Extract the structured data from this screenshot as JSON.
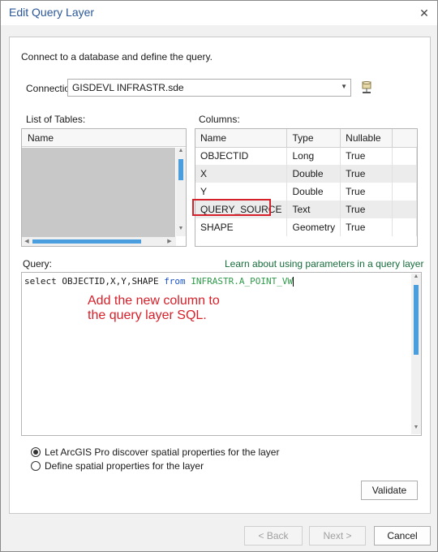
{
  "window": {
    "title": "Edit Query Layer"
  },
  "intro": "Connect to a database and define the query.",
  "connection": {
    "label": "Connection:",
    "value": "GISDEVL INFRASTR.sde"
  },
  "tables": {
    "label": "List of Tables:",
    "header": "Name"
  },
  "columns": {
    "label": "Columns:",
    "headers": [
      "Name",
      "Type",
      "Nullable"
    ],
    "rows": [
      [
        "OBJECTID",
        "Long",
        "True"
      ],
      [
        "X",
        "Double",
        "True"
      ],
      [
        "Y",
        "Double",
        "True"
      ],
      [
        "QUERY_SOURCE",
        "Text",
        "True"
      ],
      [
        "SHAPE",
        "Geometry",
        "True"
      ]
    ]
  },
  "query": {
    "label": "Query:",
    "learn_link": "Learn about using parameters in a query layer",
    "sql_prefix": "select OBJECTID,X,Y,SHAPE ",
    "sql_keyword": "from",
    "sql_table": "INFRASTR.A_POINT_VW",
    "annotation": "Add the new column to\nthe query layer SQL."
  },
  "options": {
    "discover": "Let ArcGIS Pro discover spatial properties for the layer",
    "define": "Define spatial properties for the layer"
  },
  "buttons": {
    "validate": "Validate",
    "back": "< Back",
    "next": "Next >",
    "cancel": "Cancel"
  },
  "colors": {
    "title": "#2b5797",
    "highlight": "#d6202a",
    "accent": "#4a9ede"
  }
}
